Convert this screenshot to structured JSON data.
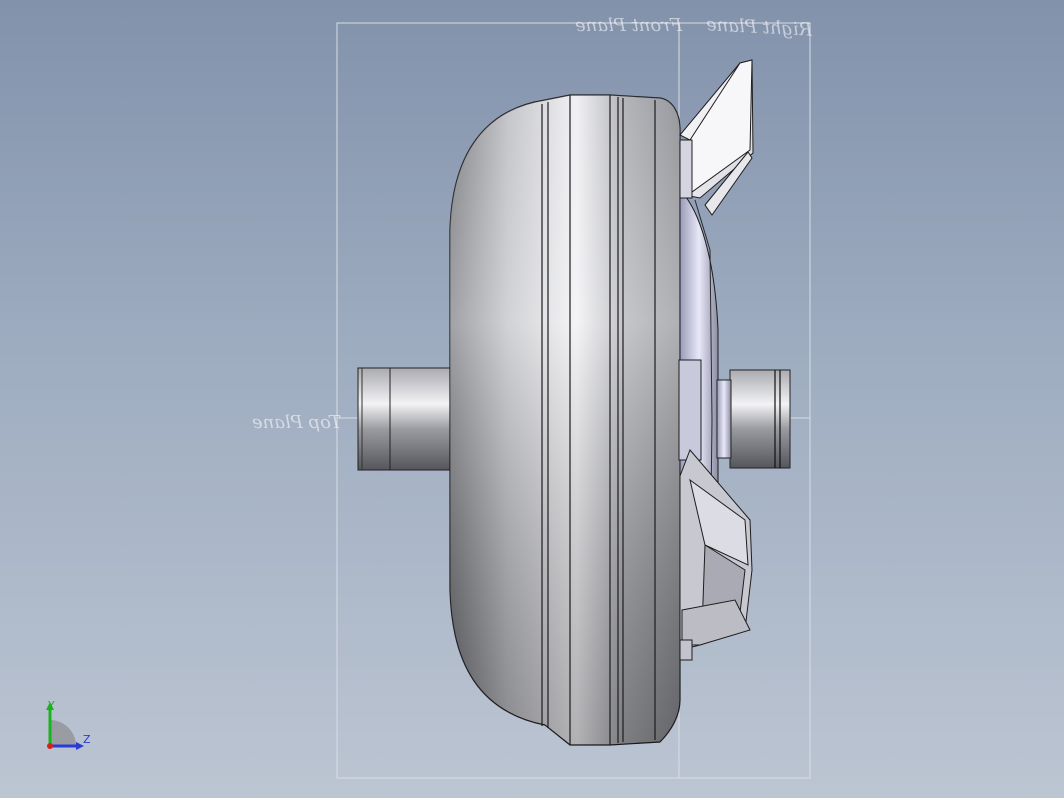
{
  "viewport": {
    "planes": {
      "front": "Front Plane",
      "right": "Right Plane",
      "top": "Top Plane"
    },
    "model": "torque-converter",
    "triad": {
      "y": "Y",
      "z": "Z",
      "x_color": "#d42020",
      "y_color": "#1bb31b",
      "z_color": "#2b3bd6"
    },
    "colors": {
      "background_top": "#8292ab",
      "background_bottom": "#bcc5d2",
      "body": "#b7b8bd"
    }
  }
}
